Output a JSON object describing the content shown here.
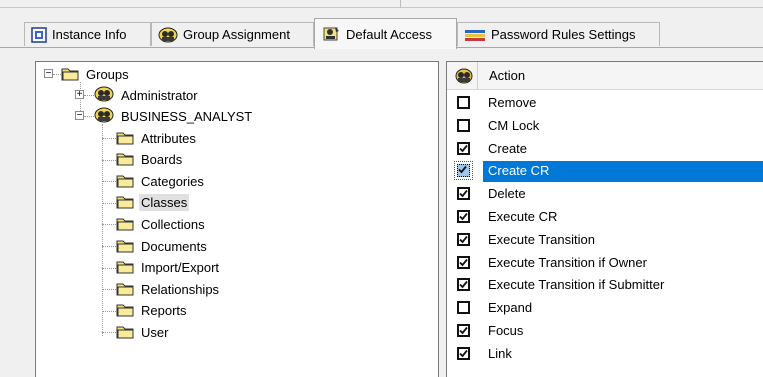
{
  "tabs": [
    {
      "label": "Instance Info",
      "icon": "instance-info-icon"
    },
    {
      "label": "Group Assignment",
      "icon": "group-icon"
    },
    {
      "label": "Default Access",
      "icon": "access-icon",
      "active": true
    },
    {
      "label": "Password Rules Settings",
      "icon": "password-rules-icon"
    }
  ],
  "tree": {
    "root": {
      "label": "Groups",
      "expanded": true
    },
    "groups": [
      {
        "label": "Administrator",
        "expanded": false
      },
      {
        "label": "BUSINESS_ANALYST",
        "expanded": true
      }
    ],
    "folders": [
      "Attributes",
      "Boards",
      "Categories",
      "Classes",
      "Collections",
      "Documents",
      "Import/Export",
      "Relationships",
      "Reports",
      "User"
    ],
    "selected_folder": "Classes"
  },
  "list": {
    "header": "Action",
    "rows": [
      {
        "label": "Remove",
        "checked": false
      },
      {
        "label": "CM Lock",
        "checked": false
      },
      {
        "label": "Create",
        "checked": true
      },
      {
        "label": "Create CR",
        "checked": true,
        "selected": true
      },
      {
        "label": "Delete",
        "checked": true
      },
      {
        "label": "Execute CR",
        "checked": true
      },
      {
        "label": "Execute Transition",
        "checked": true
      },
      {
        "label": "Execute Transition if Owner",
        "checked": true
      },
      {
        "label": "Execute Transition if Submitter",
        "checked": true
      },
      {
        "label": "Expand",
        "checked": false
      },
      {
        "label": "Focus",
        "checked": true
      },
      {
        "label": "Link",
        "checked": true
      }
    ]
  },
  "colors": {
    "selection": "#0078d7",
    "folder": "#f4e27a",
    "group_icon": "#2a2a2a"
  }
}
